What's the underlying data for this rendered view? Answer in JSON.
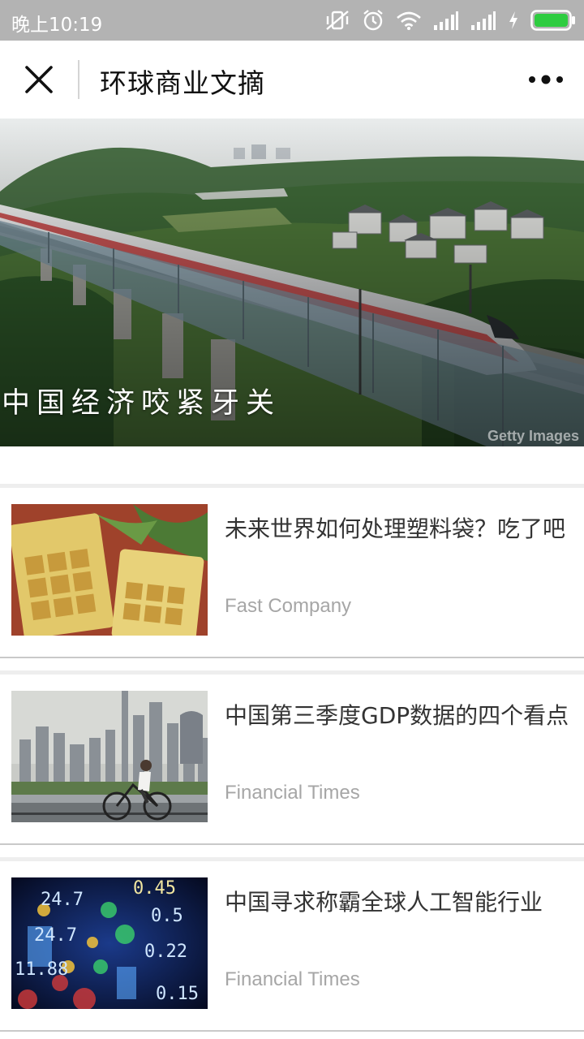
{
  "status_bar": {
    "time": "晚上10:19",
    "icons": [
      "vibrate-off-icon",
      "alarm-icon",
      "wifi-icon",
      "signal-icon",
      "signal-icon",
      "charging-icon",
      "battery-icon"
    ]
  },
  "title_bar": {
    "title": "环球商业文摘",
    "close_icon": "close-icon",
    "more_icon": "more-icon"
  },
  "hero": {
    "caption": "中国经济咬紧牙关",
    "credit": "Getty Images"
  },
  "articles": [
    {
      "title": "未来世界如何处理塑料袋？吃了吧",
      "source": "Fast Company"
    },
    {
      "title": "中国第三季度GDP数据的四个看点",
      "source": "Financial Times"
    },
    {
      "title": "中国寻求称霸全球人工智能行业",
      "source": "Financial Times"
    }
  ],
  "colors": {
    "status_bar": "#b3b3b3",
    "battery": "#2ecc40",
    "source_text": "#a6a6a6"
  }
}
